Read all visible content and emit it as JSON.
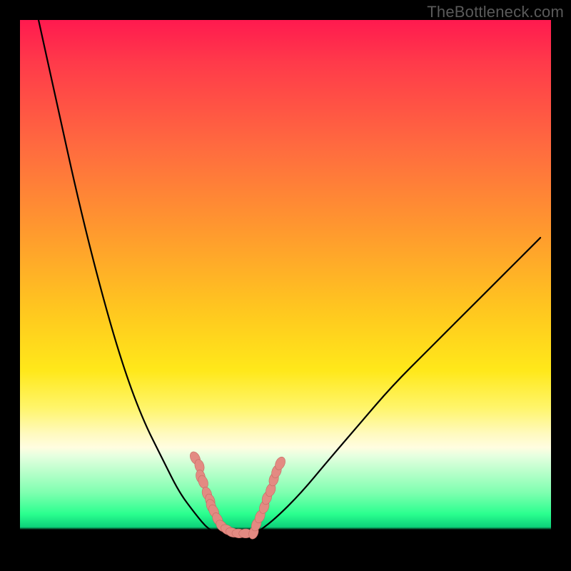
{
  "watermark": "TheBottleneck.com",
  "chart_data": {
    "type": "line",
    "title": "",
    "xlabel": "",
    "ylabel": "",
    "xlim": [
      0,
      1
    ],
    "ylim": [
      0,
      1
    ],
    "series": [
      {
        "name": "left-curve",
        "x": [
          0.035,
          0.07,
          0.11,
          0.15,
          0.19,
          0.23,
          0.27,
          0.3,
          0.33,
          0.355,
          0.38
        ],
        "values": [
          1.0,
          0.84,
          0.66,
          0.5,
          0.36,
          0.25,
          0.17,
          0.11,
          0.07,
          0.04,
          0.03
        ]
      },
      {
        "name": "right-curve",
        "x": [
          0.44,
          0.48,
          0.53,
          0.58,
          0.64,
          0.7,
          0.77,
          0.84,
          0.91,
          0.98
        ],
        "values": [
          0.03,
          0.06,
          0.11,
          0.17,
          0.24,
          0.31,
          0.38,
          0.45,
          0.52,
          0.59
        ]
      }
    ],
    "valley_floor": {
      "x": [
        0.38,
        0.44
      ],
      "value": 0.03
    },
    "marker_clusters": [
      {
        "name": "left-cluster",
        "points": [
          {
            "x": 0.33,
            "y": 0.175
          },
          {
            "x": 0.338,
            "y": 0.16
          },
          {
            "x": 0.34,
            "y": 0.14
          },
          {
            "x": 0.345,
            "y": 0.13
          },
          {
            "x": 0.352,
            "y": 0.108
          },
          {
            "x": 0.358,
            "y": 0.095
          },
          {
            "x": 0.36,
            "y": 0.085
          },
          {
            "x": 0.365,
            "y": 0.075
          },
          {
            "x": 0.372,
            "y": 0.06
          },
          {
            "x": 0.38,
            "y": 0.047
          },
          {
            "x": 0.39,
            "y": 0.04
          },
          {
            "x": 0.4,
            "y": 0.035
          },
          {
            "x": 0.412,
            "y": 0.033
          },
          {
            "x": 0.425,
            "y": 0.033
          }
        ]
      },
      {
        "name": "right-cluster",
        "points": [
          {
            "x": 0.44,
            "y": 0.035
          },
          {
            "x": 0.445,
            "y": 0.05
          },
          {
            "x": 0.452,
            "y": 0.065
          },
          {
            "x": 0.46,
            "y": 0.083
          },
          {
            "x": 0.465,
            "y": 0.1
          },
          {
            "x": 0.472,
            "y": 0.115
          },
          {
            "x": 0.478,
            "y": 0.135
          },
          {
            "x": 0.483,
            "y": 0.15
          },
          {
            "x": 0.49,
            "y": 0.165
          }
        ]
      }
    ],
    "marker_style": {
      "fill": "#e38a82",
      "stroke": "#c46a62",
      "r_base": 7
    },
    "curve_style": {
      "stroke": "#000000",
      "width": 2.2
    }
  }
}
